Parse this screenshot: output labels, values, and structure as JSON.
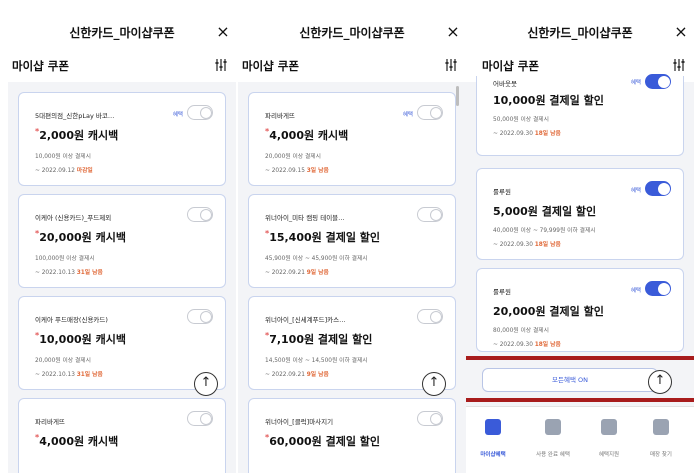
{
  "header": {
    "title": "신한카드_마이샵쿠폰",
    "close": "×",
    "subtitle": "마이샵 쿠폰"
  },
  "panels": [
    {
      "cards": [
        {
          "name": "5대편의점_신한pLay 바코…",
          "badge": "혜택",
          "amount": "2,000원 캐시백",
          "cond": "10,000원 이상 결제시",
          "period": "~ 2022.09.12",
          "left": "마감일",
          "toggle": "off"
        },
        {
          "name": "이케아 (신용카드)_푸드제외",
          "badge": "",
          "amount": "20,000원 캐시백",
          "cond": "100,000원 이상 결제시",
          "period": "~ 2022.10.13",
          "left": "31일 남음",
          "toggle": "off"
        },
        {
          "name": "이케아 푸드매장(신용카드)",
          "badge": "",
          "amount": "10,000원 캐시백",
          "cond": "20,000원 이상 결제시",
          "period": "~ 2022.10.13",
          "left": "31일 남음",
          "toggle": "off"
        },
        {
          "name": "파리바게뜨",
          "badge": "",
          "amount": "4,000원 캐시백",
          "cond": "",
          "period": "",
          "left": "",
          "toggle": "off"
        }
      ],
      "fab": "↑"
    },
    {
      "cards": [
        {
          "name": "파리바게뜨",
          "badge": "혜택",
          "amount": "4,000원 캐시백",
          "cond": "20,000원 이상 결제시",
          "period": "~ 2022.09.15",
          "left": "3일 남음",
          "toggle": "off"
        },
        {
          "name": "위너아이_미타 캠핑 테이블…",
          "badge": "",
          "amount": "15,400원 결제일 할인",
          "cond": "45,900원 이상 ~ 45,900원 이하 결제시",
          "period": "~ 2022.09.21",
          "left": "9일 남음",
          "toggle": "off"
        },
        {
          "name": "위너아이_[신세계푸드]카스…",
          "badge": "",
          "amount": "7,100원 결제일 할인",
          "cond": "14,500원 이상 ~ 14,500원 이하 결제시",
          "period": "~ 2022.09.21",
          "left": "9일 남음",
          "toggle": "off"
        },
        {
          "name": "위너아이_[클럭]마사지기",
          "badge": "",
          "amount": "60,000원 결제일 할인",
          "cond": "",
          "period": "",
          "left": "",
          "toggle": "off"
        }
      ],
      "fab": "↑"
    },
    {
      "cards": [
        {
          "name": "어바웃뭇",
          "badge": "혜택",
          "amount": "10,000원 결제일 할인",
          "cond": "50,000원 이상 결제시",
          "period": "~ 2022.09.30",
          "left": "18일 남음",
          "toggle": "on"
        },
        {
          "name": "룰루원",
          "badge": "혜택",
          "amount": "5,000원 결제일 할인",
          "cond": "40,000원 이상 ~ 79,999원 이하 결제시",
          "period": "~ 2022.09.30",
          "left": "18일 남음",
          "toggle": "on"
        },
        {
          "name": "룰루원",
          "badge": "혜택",
          "amount": "20,000원 결제일 할인",
          "cond": "80,000원 이상 결제시",
          "period": "~ 2022.09.30",
          "left": "18일 남음",
          "toggle": "on"
        }
      ],
      "all_button": "모든혜택 ON",
      "fab": "↑",
      "nav": [
        {
          "label": "마이샵혜택",
          "icon": "coupon-icon",
          "active": true
        },
        {
          "label": "사용 완료 혜택",
          "icon": "check-list-icon",
          "active": false
        },
        {
          "label": "혜택지원",
          "icon": "edit-icon",
          "active": false
        },
        {
          "label": "매장 찾기",
          "icon": "location-pin-icon",
          "active": false
        }
      ]
    }
  ],
  "colors": {
    "accent": "#3a5bd9",
    "days_left": "#e06a3a",
    "highlight_frame": "#a81c1c",
    "card_border": "#c9d4ee"
  }
}
